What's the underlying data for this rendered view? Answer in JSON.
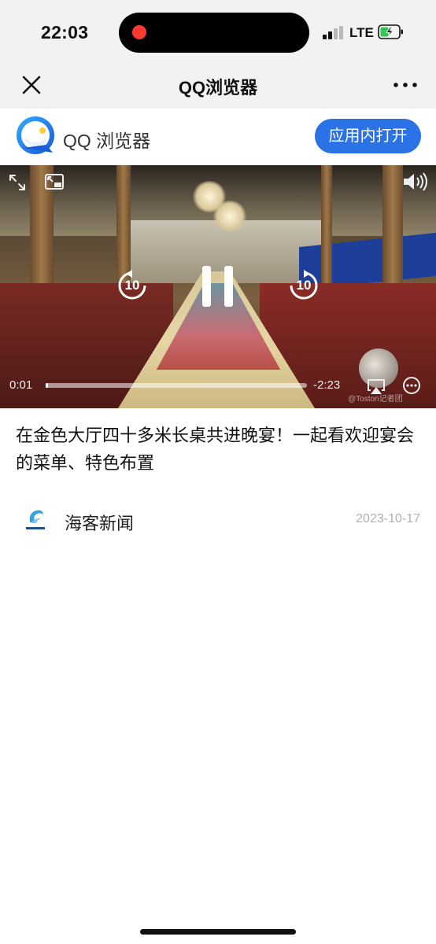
{
  "status_bar": {
    "time": "22:03",
    "network": "LTE",
    "recording_indicator_color": "#ff3b30",
    "battery_icon": "battery-charging-icon"
  },
  "nav_bar": {
    "title": "QQ浏览器",
    "close_icon": "close-icon",
    "more_icon": "more-icon"
  },
  "banner": {
    "app_name": "QQ 浏览器",
    "open_button_label": "应用内打开",
    "accent_color": "#2a72e5"
  },
  "video": {
    "elapsed": "0:01",
    "remaining": "-2:23",
    "progress_fraction": 0.01,
    "skip_back_label": "10",
    "skip_forward_label": "10",
    "watermark": "@Toston记者团"
  },
  "article": {
    "title": "在金色大厅四十多米长桌共进晚宴！一起看欢迎宴会的菜单、特色布置",
    "source_name": "海客新闻",
    "date": "2023-10-17"
  }
}
